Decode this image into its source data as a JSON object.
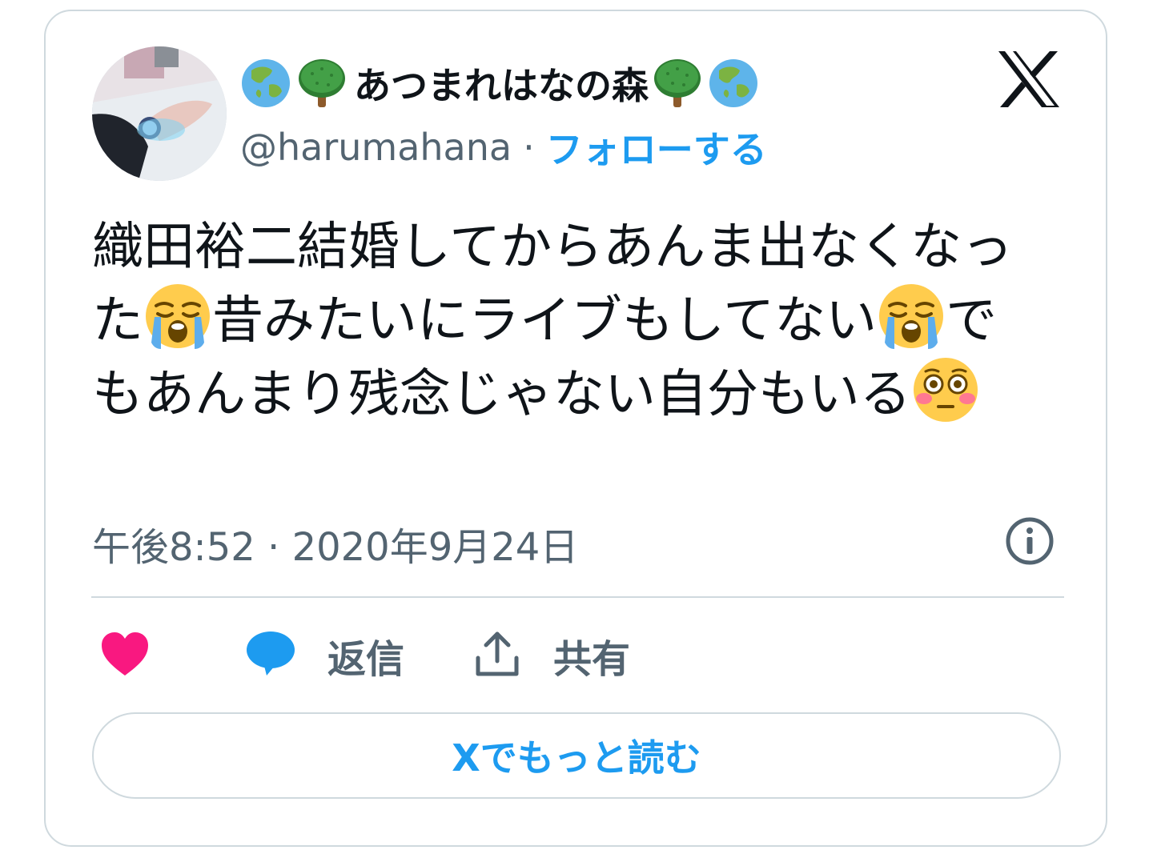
{
  "user": {
    "display_name": "あつまれはなの森",
    "name_prefix_icons": [
      "globe-asia-icon",
      "tree-icon"
    ],
    "name_suffix_icons": [
      "tree-icon",
      "globe-asia-icon"
    ],
    "handle": "@harumahana",
    "separator": "·",
    "follow_label": "フォローする"
  },
  "tweet": {
    "segments": [
      {
        "text": "織田裕二結婚してからあんま出なくなった"
      },
      {
        "emoji": "loudly-crying-face-icon"
      },
      {
        "text": "昔みたいにライブもしてない"
      },
      {
        "emoji": "loudly-crying-face-icon"
      },
      {
        "text": "でもあんまり残念じゃない自分もいる"
      },
      {
        "emoji": "flushed-face-icon"
      }
    ],
    "text_1": "織田裕二結婚してからあんま出なくなった",
    "text_2": "昔みたいにライブもしてない",
    "text_3": "でもあんまり残念じゃない自分もいる",
    "timestamp": "午後8:52 · 2020年9月24日"
  },
  "actions": {
    "like_icon": "heart-icon",
    "reply_icon": "speech-bubble-icon",
    "reply_label": "返信",
    "share_icon": "share-upload-icon",
    "share_label": "共有"
  },
  "read_more_label": "Xでもっと読む",
  "colors": {
    "accent": "#1d9bf0",
    "like": "#f91880",
    "secondary_text": "#536471",
    "border": "#cfd9de"
  }
}
